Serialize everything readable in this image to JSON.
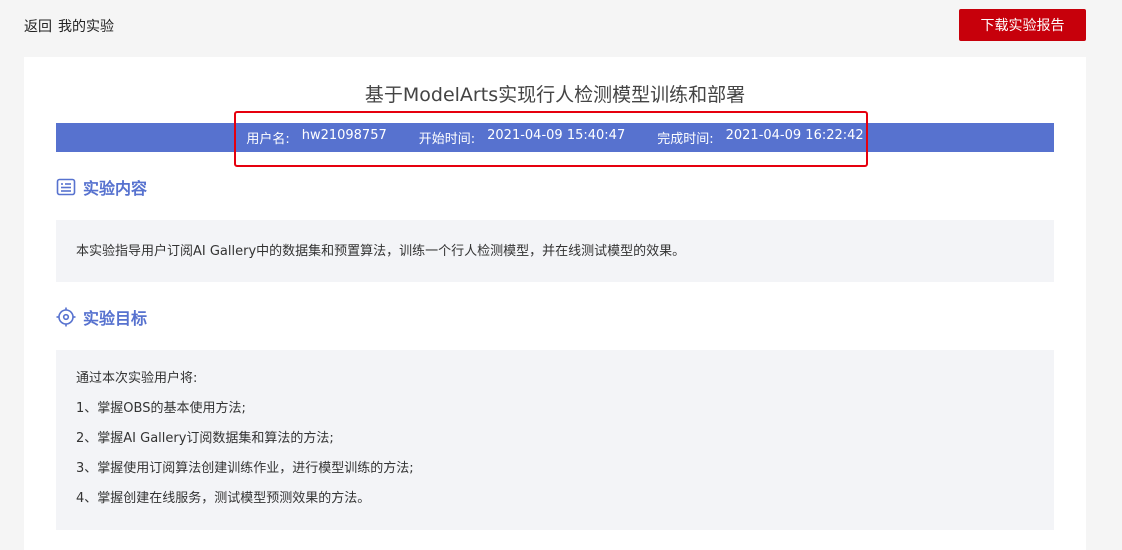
{
  "topbar": {
    "back_label": "返回",
    "breadcrumb": "我的实验",
    "download_label": "下载实验报告"
  },
  "report": {
    "title": "基于ModelArts实现行人检测模型训练和部署",
    "info": {
      "user_label": "用户名:",
      "user_value": "hw21098757",
      "start_label": "开始时间:",
      "start_value": "2021-04-09 15:40:47",
      "end_label": "完成时间:",
      "end_value": "2021-04-09 16:22:42"
    }
  },
  "content_section": {
    "title": "实验内容",
    "icon": "document-list-icon",
    "text": "本实验指导用户订阅AI Gallery中的数据集和预置算法，训练一个行人检测模型，并在线测试模型的效果。"
  },
  "goal_section": {
    "title": "实验目标",
    "icon": "target-icon",
    "intro": "通过本次实验用户将:",
    "items": [
      "1、掌握OBS的基本使用方法;",
      "2、掌握AI Gallery订阅数据集和算法的方法;",
      "3、掌握使用订阅算法创建训练作业，进行模型训练的方法;",
      "4、掌握创建在线服务，测试模型预测效果的方法。"
    ]
  },
  "colors": {
    "accent": "#5772cf",
    "brand_red": "#c7000b",
    "highlight_red": "#e6000e",
    "panel_bg": "#f3f4f7"
  }
}
